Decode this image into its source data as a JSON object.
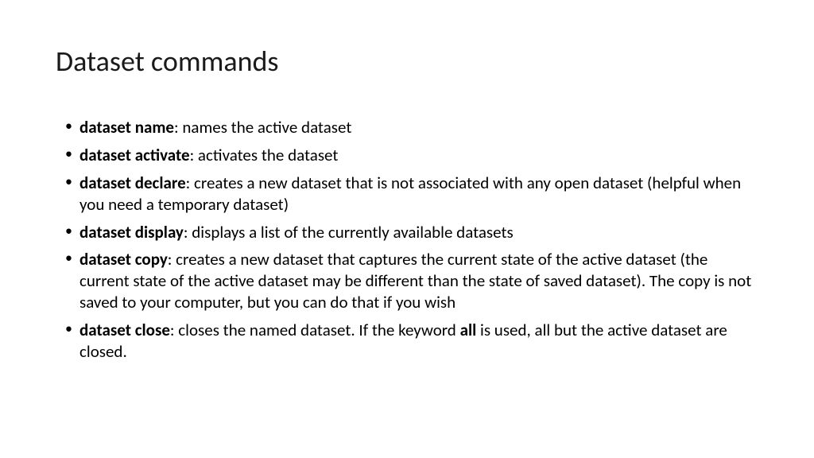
{
  "title": "Dataset commands",
  "items": [
    {
      "command": "dataset name",
      "desc": ": names the active dataset"
    },
    {
      "command": "dataset activate",
      "desc": ": activates the dataset"
    },
    {
      "command": "dataset declare",
      "desc": ": creates a new dataset that is not associated with any open dataset (helpful when you need a temporary dataset)"
    },
    {
      "command": "dataset display",
      "desc": ":  displays a list of the currently available datasets"
    },
    {
      "command": "dataset copy",
      "desc": ":  creates a new dataset that captures the current state of the active dataset (the current state of the active dataset may be different than the state of saved dataset).  The copy is not saved to your computer, but you can do that if you wish"
    },
    {
      "command": "dataset close",
      "desc_before": ":  closes the named dataset. If the keyword ",
      "keyword": "all",
      "desc_after": " is used, all but the active dataset are closed."
    }
  ]
}
